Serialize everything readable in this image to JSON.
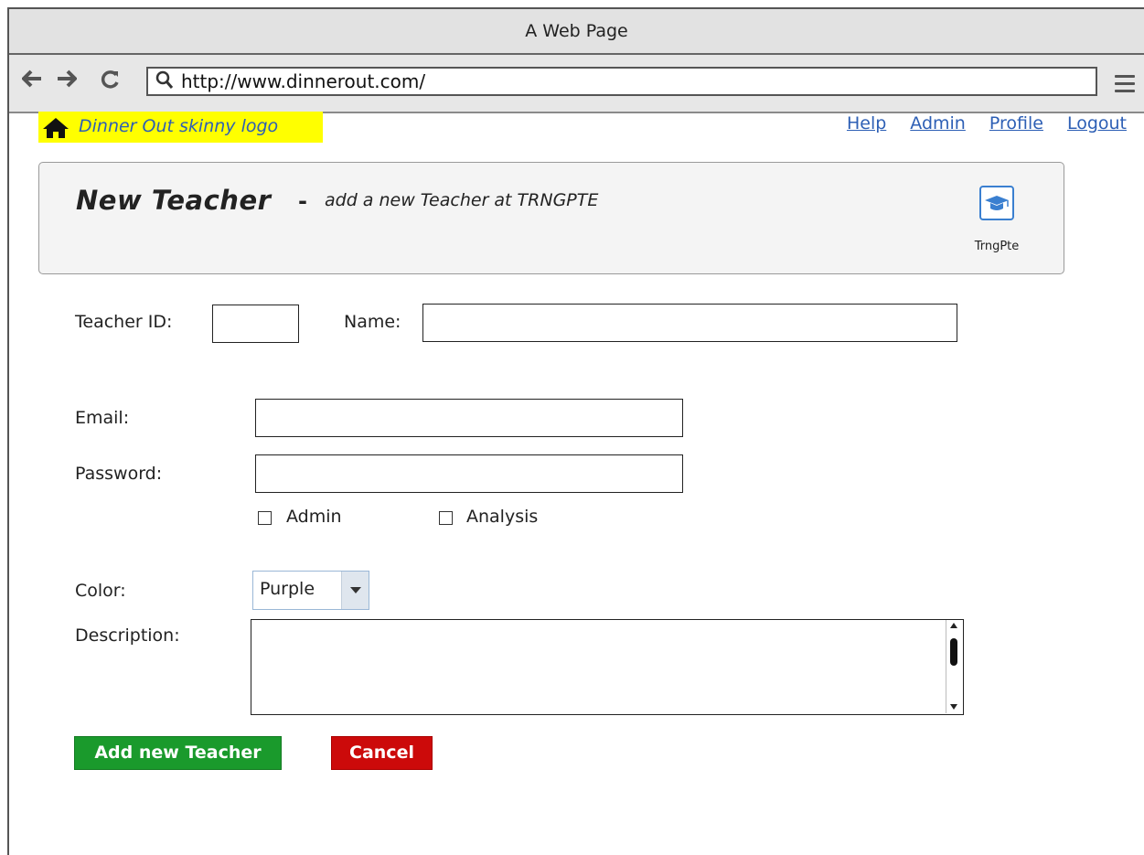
{
  "browser": {
    "window_title": "A Web Page",
    "url": "http://www.dinnerout.com/",
    "back_icon": "arrow-left-icon",
    "forward_icon": "arrow-right-icon",
    "reload_icon": "reload-icon",
    "search_icon": "search-icon",
    "menu_icon": "hamburger-menu-icon"
  },
  "header": {
    "logo_text": "Dinner Out skinny logo",
    "logo_icon": "home-icon",
    "logo_bg": "#ffff00",
    "nav": [
      "Help",
      "Admin",
      "Profile",
      "Logout"
    ],
    "link_color": "#2d5fb5"
  },
  "banner": {
    "title": "New Teacher",
    "dash": "-",
    "subtitle": "add a new Teacher at TRNGPTE",
    "badge_icon": "graduation-cap-icon",
    "badge_label": "TrngPte"
  },
  "form": {
    "teacher_id_label": "Teacher ID:",
    "teacher_id_value": "",
    "name_label": "Name:",
    "name_value": "",
    "email_label": "Email:",
    "email_value": "",
    "password_label": "Password:",
    "password_value": "",
    "admin_label": "Admin",
    "admin_checked": false,
    "analysis_label": "Analysis",
    "analysis_checked": false,
    "color_label": "Color:",
    "color_value": "Purple",
    "description_label": "Description:",
    "description_value": ""
  },
  "buttons": {
    "add_label": "Add new Teacher",
    "add_color": "#1a9a2c",
    "cancel_label": "Cancel",
    "cancel_color": "#cc0a0a"
  }
}
